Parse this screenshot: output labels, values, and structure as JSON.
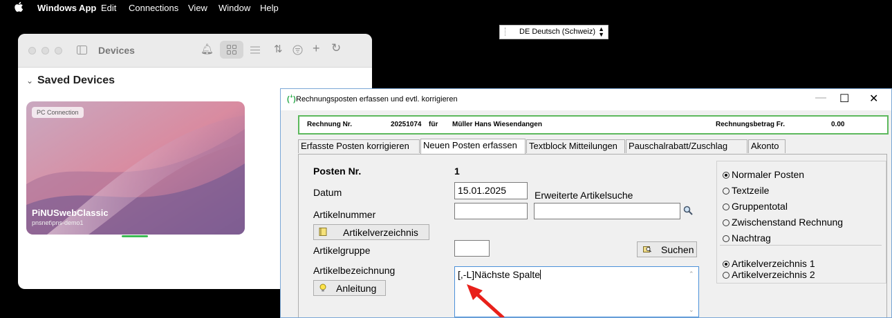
{
  "menubar": {
    "app_name": "Windows App",
    "items": [
      "Edit",
      "Connections",
      "View",
      "Window",
      "Help"
    ]
  },
  "language": {
    "selected": "DE Deutsch (Schweiz)"
  },
  "devices_window": {
    "title": "Devices",
    "section_title": "Saved Devices",
    "card": {
      "badge": "PC Connection",
      "name": "PiNUSwebClassic",
      "subtitle": "pnsnet\\pns-demo1"
    }
  },
  "dialog": {
    "title": "Rechnungsposten erfassen und evtl. korrigieren",
    "info": {
      "invoice_label": "Rechnung Nr.",
      "invoice_no": "20251074",
      "for_label": "für",
      "customer": "Müller Hans Wiesendangen",
      "amount_label": "Rechnungsbetrag Fr.",
      "amount": "0.00"
    },
    "tabs": [
      {
        "label": "Erfasste Posten korrigieren",
        "active": false
      },
      {
        "label": "Neuen Posten erfassen",
        "active": true
      },
      {
        "label": "Textblock Mitteilungen",
        "active": false
      },
      {
        "label": "Pauschalrabatt/Zuschlag",
        "active": false
      },
      {
        "label": "Akonto",
        "active": false
      }
    ],
    "form": {
      "posten_label": "Posten Nr.",
      "posten_value": "1",
      "datum_label": "Datum",
      "datum_value": "15.01.2025",
      "erweiterte_label": "Erweiterte Artikelsuche",
      "artikelnummer_label": "Artikelnummer",
      "artikelnummer_value": "",
      "artikelsuche_value": "",
      "artikelverzeichnis_button": "Artikelverzeichnis",
      "artikelgruppe_label": "Artikelgruppe",
      "artikelgruppe_value": "",
      "suchen_button": "Suchen",
      "bezeichnung_label": "Artikelbezeichnung",
      "bezeichnung_value": "[,-L]Nächste Spalte",
      "anleitung_button": "Anleitung"
    },
    "posten_type": {
      "options": [
        "Normaler Posten",
        "Textzeile",
        "Gruppentotal",
        "Zwischenstand Rechnung",
        "Nachtrag"
      ],
      "selected": "Normaler Posten"
    },
    "verzeichnis": {
      "options": [
        "Artikelverzeichnis 1",
        "Artikelverzeichnis 2"
      ],
      "selected": "Artikelverzeichnis 1"
    }
  },
  "colors": {
    "accent_green": "#5cb85c",
    "annotation_red": "#e8201a",
    "card_gradient": [
      "#d98ba0",
      "#8a6a9c"
    ]
  },
  "icons": [
    "apple-icon",
    "bell-icon",
    "grid-view-icon",
    "list-view-icon",
    "sort-icon",
    "filter-icon",
    "plus-icon",
    "refresh-icon",
    "sidebar-icon",
    "search-icon",
    "book-icon",
    "lightbulb-icon",
    "search-folder-icon",
    "app-logo-icon"
  ]
}
